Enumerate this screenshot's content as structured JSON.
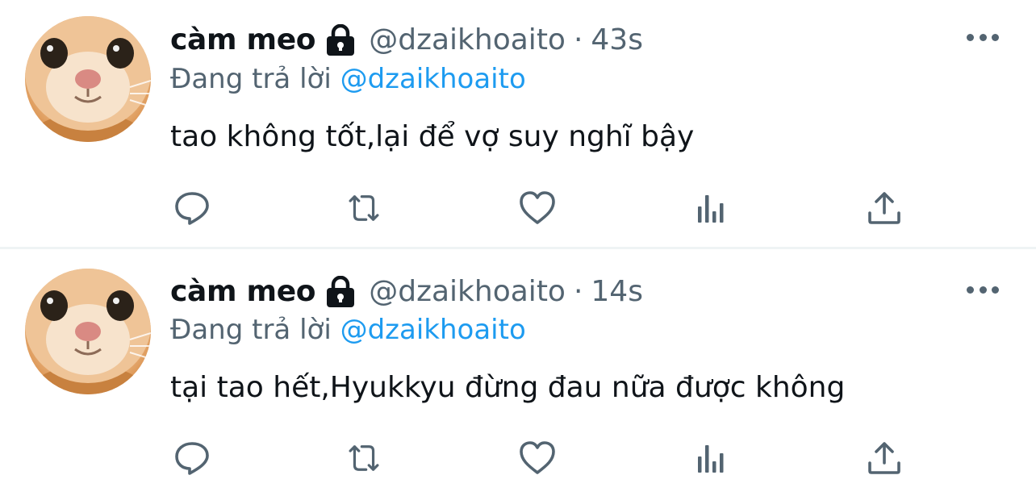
{
  "tweets": [
    {
      "display_name": "càm meo",
      "handle": "@dzaikhoaito",
      "separator": "·",
      "time": "43s",
      "reply_prefix": "Đang trả lời",
      "reply_to": "@dzaikhoaito",
      "text": "tao không tốt,lại để vợ suy nghĩ bậy"
    },
    {
      "display_name": "càm meo",
      "handle": "@dzaikhoaito",
      "separator": "·",
      "time": "14s",
      "reply_prefix": "Đang trả lời",
      "reply_to": "@dzaikhoaito",
      "text": "tại tao hết,Hyukkyu đừng đau nữa được không"
    }
  ],
  "icons": {
    "lock": "lock-icon",
    "more": "more-icon",
    "reply": "reply-icon",
    "retweet": "retweet-icon",
    "like": "heart-icon",
    "views": "analytics-icon",
    "share": "share-icon"
  },
  "colors": {
    "text": "#0f1419",
    "secondary": "#536471",
    "mention": "#1d9bf0",
    "divider": "#eff3f4"
  }
}
